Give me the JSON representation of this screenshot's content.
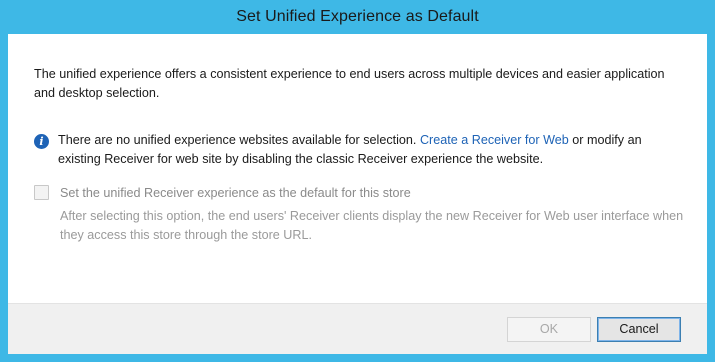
{
  "window": {
    "title": "Set Unified Experience as Default"
  },
  "intro_text": "The unified experience offers a consistent experience to end users across multiple devices and easier application and desktop selection.",
  "info": {
    "icon": "info-icon",
    "text_before_link": "There are no unified experience websites available for selection. ",
    "link_text": "Create a Receiver for Web",
    "text_after_link": " or modify an existing Receiver for web site by disabling the classic Receiver experience the website."
  },
  "option": {
    "checked": false,
    "enabled": false,
    "label": "Set the unified Receiver experience as the default for this store",
    "description": "After selecting this option, the end users' Receiver clients display the new Receiver for Web user interface when they access this store through the store URL."
  },
  "buttons": {
    "ok_label": "OK",
    "cancel_label": "Cancel"
  },
  "colors": {
    "frame": "#3eb8e6",
    "link": "#1e63b6",
    "info_icon": "#1e63b6"
  }
}
